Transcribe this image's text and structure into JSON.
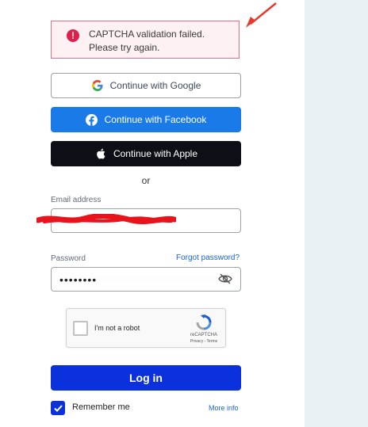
{
  "alert": {
    "message": "CAPTCHA validation failed. Please try again.",
    "icon": "!"
  },
  "social": {
    "google_label": "Continue with Google",
    "facebook_label": "Continue with Facebook",
    "apple_label": "Continue with Apple"
  },
  "divider": {
    "or": "or"
  },
  "email": {
    "label": "Email address",
    "value": ""
  },
  "password": {
    "label": "Password",
    "masked_value": "••••••••",
    "forgot_link": "Forgot password?"
  },
  "captcha": {
    "label": "I'm not a robot",
    "brand": "reCAPTCHA",
    "links": "Privacy - Terms"
  },
  "login": {
    "button_label": "Log in"
  },
  "remember": {
    "label": "Remember me",
    "checked": true,
    "more_info": "More info"
  },
  "colors": {
    "primary": "#0b31dc",
    "facebook": "#1a7ae8",
    "apple": "#0e0f16",
    "alert": "#e0204a",
    "side_panel": "#e9f1f5"
  },
  "icons": [
    "alert-icon",
    "google-icon",
    "facebook-icon",
    "apple-icon",
    "eye-slash-icon",
    "recaptcha-icon",
    "checkmark-icon"
  ]
}
